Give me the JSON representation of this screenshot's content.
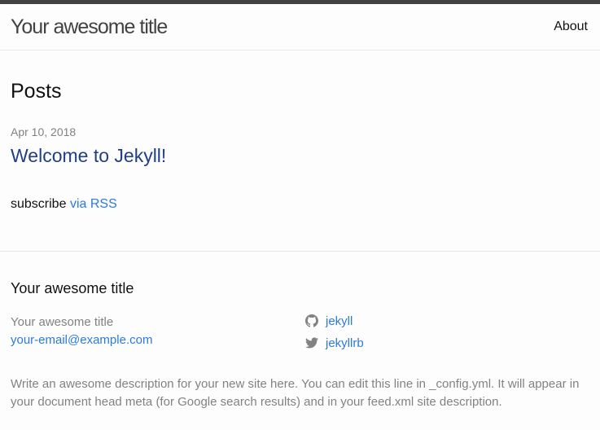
{
  "header": {
    "site_title": "Your awesome title",
    "nav": [
      {
        "label": "About"
      }
    ]
  },
  "main": {
    "heading": "Posts",
    "posts": [
      {
        "date": "Apr 10, 2018",
        "title": "Welcome to Jekyll!"
      }
    ],
    "rss": {
      "prefix": "subscribe",
      "link_label": "via RSS"
    }
  },
  "footer": {
    "heading": "Your awesome title",
    "name": "Your awesome title",
    "email": "your-email@example.com",
    "social": [
      {
        "icon": "github-icon",
        "label": "jekyll"
      },
      {
        "icon": "twitter-icon",
        "label": "jekyllrb"
      }
    ],
    "description": "Write an awesome description for your new site here. You can edit this line in _config.yml. It will appear in your document head meta (for Google search results) and in your feed.xml site description."
  },
  "colors": {
    "link": "#2a7ae2",
    "post_title": "#1f3f86",
    "text": "#111111",
    "muted": "#828282",
    "header_border": "#424242"
  }
}
